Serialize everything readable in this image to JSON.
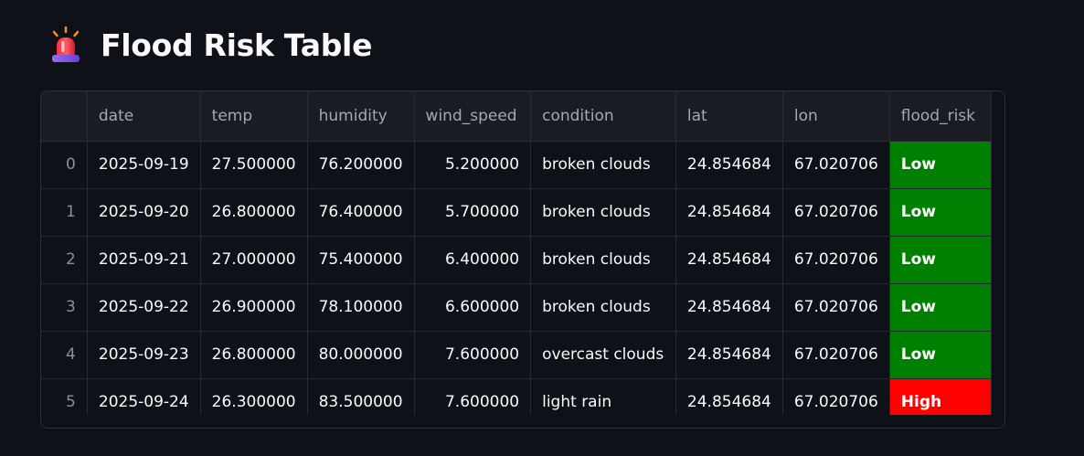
{
  "page": {
    "title": "Flood Risk Table",
    "icon": "siren-icon"
  },
  "table": {
    "columns": [
      "",
      "date",
      "temp",
      "humidity",
      "wind_speed",
      "condition",
      "lat",
      "lon",
      "flood_risk"
    ],
    "rows": [
      {
        "index": "0",
        "date": "2025-09-19",
        "temp": "27.500000",
        "humidity": "76.200000",
        "wind_speed": "5.200000",
        "condition": "broken clouds",
        "lat": "24.854684",
        "lon": "67.020706",
        "flood_risk": "Low"
      },
      {
        "index": "1",
        "date": "2025-09-20",
        "temp": "26.800000",
        "humidity": "76.400000",
        "wind_speed": "5.700000",
        "condition": "broken clouds",
        "lat": "24.854684",
        "lon": "67.020706",
        "flood_risk": "Low"
      },
      {
        "index": "2",
        "date": "2025-09-21",
        "temp": "27.000000",
        "humidity": "75.400000",
        "wind_speed": "6.400000",
        "condition": "broken clouds",
        "lat": "24.854684",
        "lon": "67.020706",
        "flood_risk": "Low"
      },
      {
        "index": "3",
        "date": "2025-09-22",
        "temp": "26.900000",
        "humidity": "78.100000",
        "wind_speed": "6.600000",
        "condition": "broken clouds",
        "lat": "24.854684",
        "lon": "67.020706",
        "flood_risk": "Low"
      },
      {
        "index": "4",
        "date": "2025-09-23",
        "temp": "26.800000",
        "humidity": "80.000000",
        "wind_speed": "7.600000",
        "condition": "overcast clouds",
        "lat": "24.854684",
        "lon": "67.020706",
        "flood_risk": "Low"
      },
      {
        "index": "5",
        "date": "2025-09-24",
        "temp": "26.300000",
        "humidity": "83.500000",
        "wind_speed": "7.600000",
        "condition": "light rain",
        "lat": "24.854684",
        "lon": "67.020706",
        "flood_risk": "High"
      }
    ]
  },
  "colors": {
    "background": "#0e1117",
    "risk_low": "#008000",
    "risk_high": "#ff0000"
  }
}
